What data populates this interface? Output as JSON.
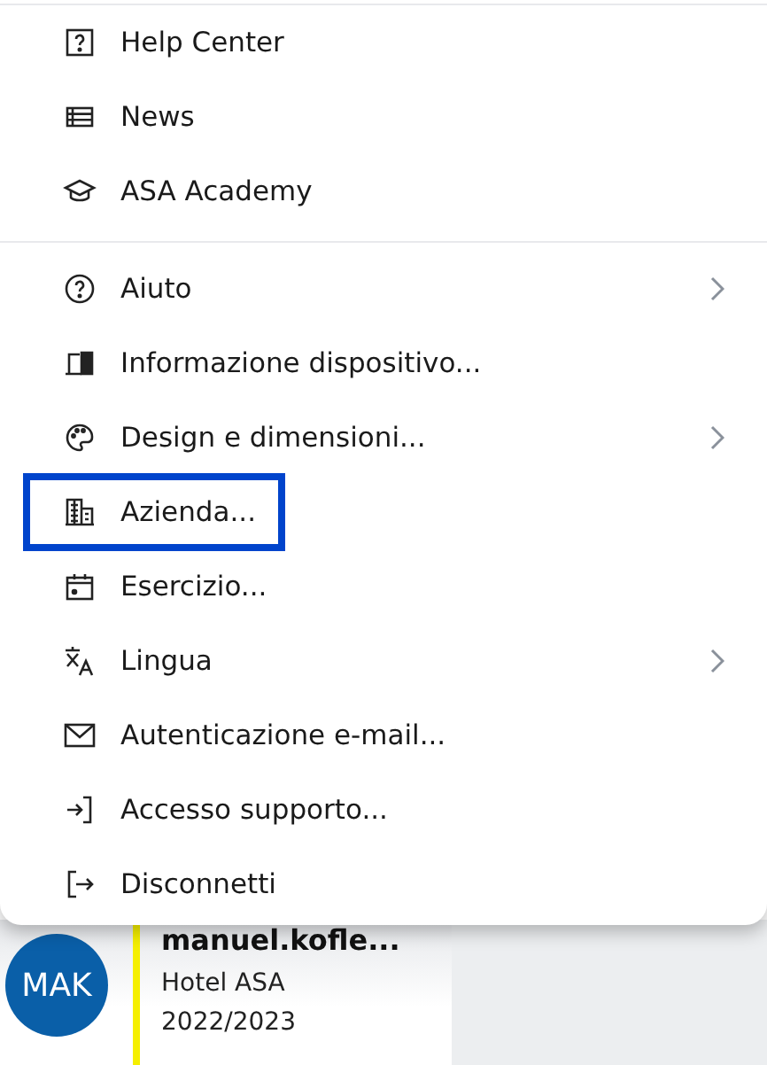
{
  "menu": {
    "sections": [
      {
        "items": [
          {
            "label": "Help Center",
            "submenu": false,
            "selected": false
          },
          {
            "label": "News",
            "submenu": false,
            "selected": false
          },
          {
            "label": "ASA Academy",
            "submenu": false,
            "selected": false
          }
        ]
      },
      {
        "items": [
          {
            "label": "Aiuto",
            "submenu": true,
            "selected": false
          },
          {
            "label": "Informazione dispositivo...",
            "submenu": false,
            "selected": false
          },
          {
            "label": "Design e dimensioni...",
            "submenu": true,
            "selected": false
          },
          {
            "label": "Azienda...",
            "submenu": false,
            "selected": true
          },
          {
            "label": "Esercizio...",
            "submenu": false,
            "selected": false
          },
          {
            "label": "Lingua",
            "submenu": true,
            "selected": false
          },
          {
            "label": "Autenticazione e-mail...",
            "submenu": false,
            "selected": false
          },
          {
            "label": "Accesso supporto...",
            "submenu": false,
            "selected": false
          },
          {
            "label": "Disconnetti",
            "submenu": false,
            "selected": false
          }
        ]
      }
    ]
  },
  "user": {
    "initials": "MAK",
    "name": "manuel.kofle...",
    "company": "Hotel ASA",
    "year": "2022/2023"
  }
}
